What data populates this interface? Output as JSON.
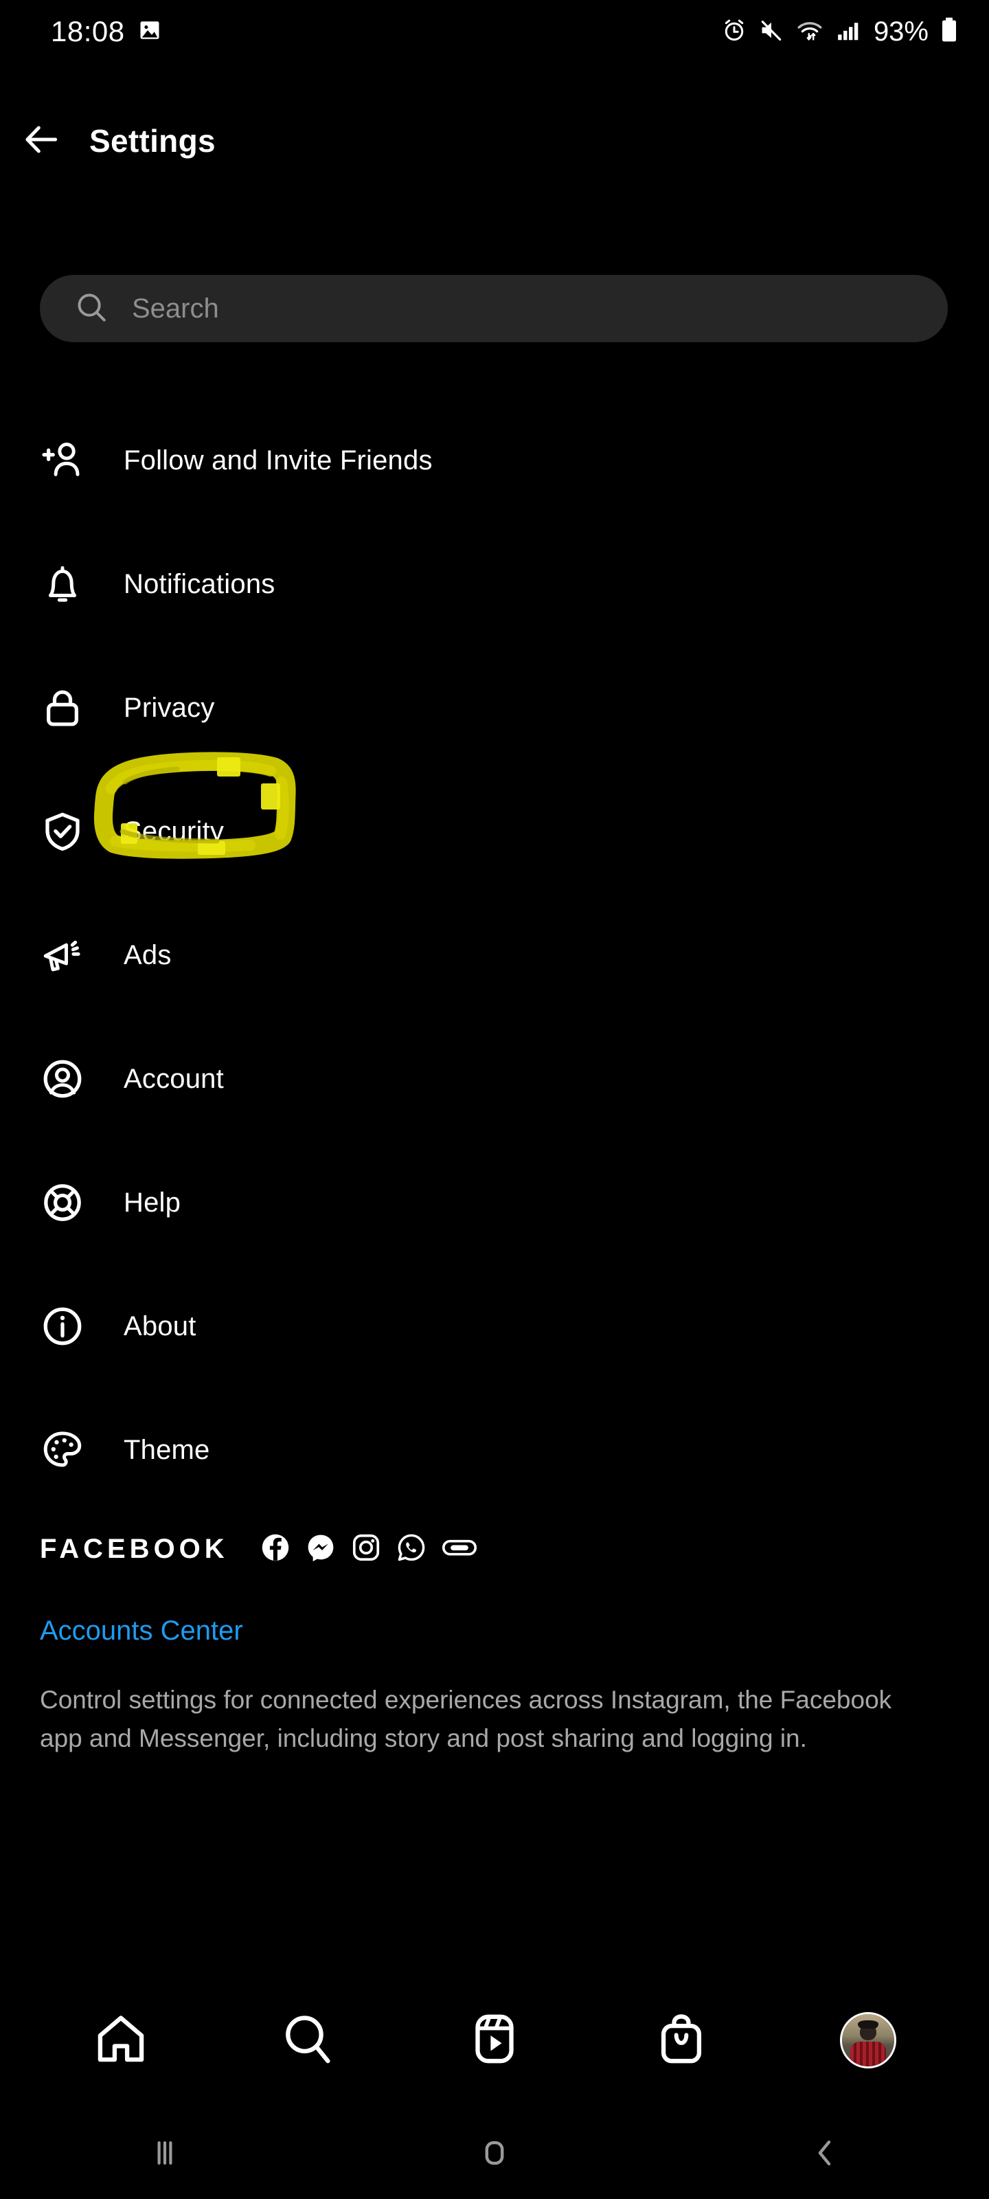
{
  "status_bar": {
    "time": "18:08",
    "battery_percent": "93%",
    "icons": [
      "photo-icon",
      "alarm-icon",
      "mute-icon",
      "wifi-icon",
      "cellular-signal-icon",
      "battery-icon"
    ]
  },
  "header": {
    "title": "Settings",
    "back_icon": "arrow-left-icon"
  },
  "search": {
    "placeholder": "Search",
    "value": "",
    "icon": "search-icon"
  },
  "menu": {
    "items": [
      {
        "label": "Follow and Invite Friends",
        "icon": "person-add-icon"
      },
      {
        "label": "Notifications",
        "icon": "bell-icon"
      },
      {
        "label": "Privacy",
        "icon": "lock-icon"
      },
      {
        "label": "Security",
        "icon": "shield-check-icon",
        "annotated": true
      },
      {
        "label": "Ads",
        "icon": "megaphone-icon"
      },
      {
        "label": "Account",
        "icon": "person-circle-icon"
      },
      {
        "label": "Help",
        "icon": "lifebuoy-icon"
      },
      {
        "label": "About",
        "icon": "info-circle-icon"
      },
      {
        "label": "Theme",
        "icon": "palette-icon"
      }
    ]
  },
  "annotation": {
    "target": "Security",
    "color": "#c9c400",
    "highlight_color": "#eeeb14",
    "shape": "hand-drawn-circle"
  },
  "facebook_section": {
    "brand": "FACEBOOK",
    "app_icons": [
      "facebook-icon",
      "messenger-icon",
      "instagram-icon",
      "whatsapp-icon",
      "oculus-icon"
    ],
    "link": "Accounts Center",
    "link_color": "#1e9bf0",
    "description": "Control settings for connected experiences across Instagram, the Facebook app and Messenger, including story and post sharing and logging in."
  },
  "bottom_nav": {
    "items": [
      {
        "name": "home",
        "icon": "home-icon"
      },
      {
        "name": "search",
        "icon": "search-icon"
      },
      {
        "name": "reels",
        "icon": "reels-icon"
      },
      {
        "name": "shop",
        "icon": "shopping-bag-icon"
      },
      {
        "name": "profile",
        "icon": "avatar-icon"
      }
    ]
  },
  "android_nav": {
    "items": [
      {
        "name": "recents",
        "icon": "recents-icon"
      },
      {
        "name": "home",
        "icon": "home-square-icon"
      },
      {
        "name": "back",
        "icon": "chevron-left-icon"
      }
    ]
  }
}
